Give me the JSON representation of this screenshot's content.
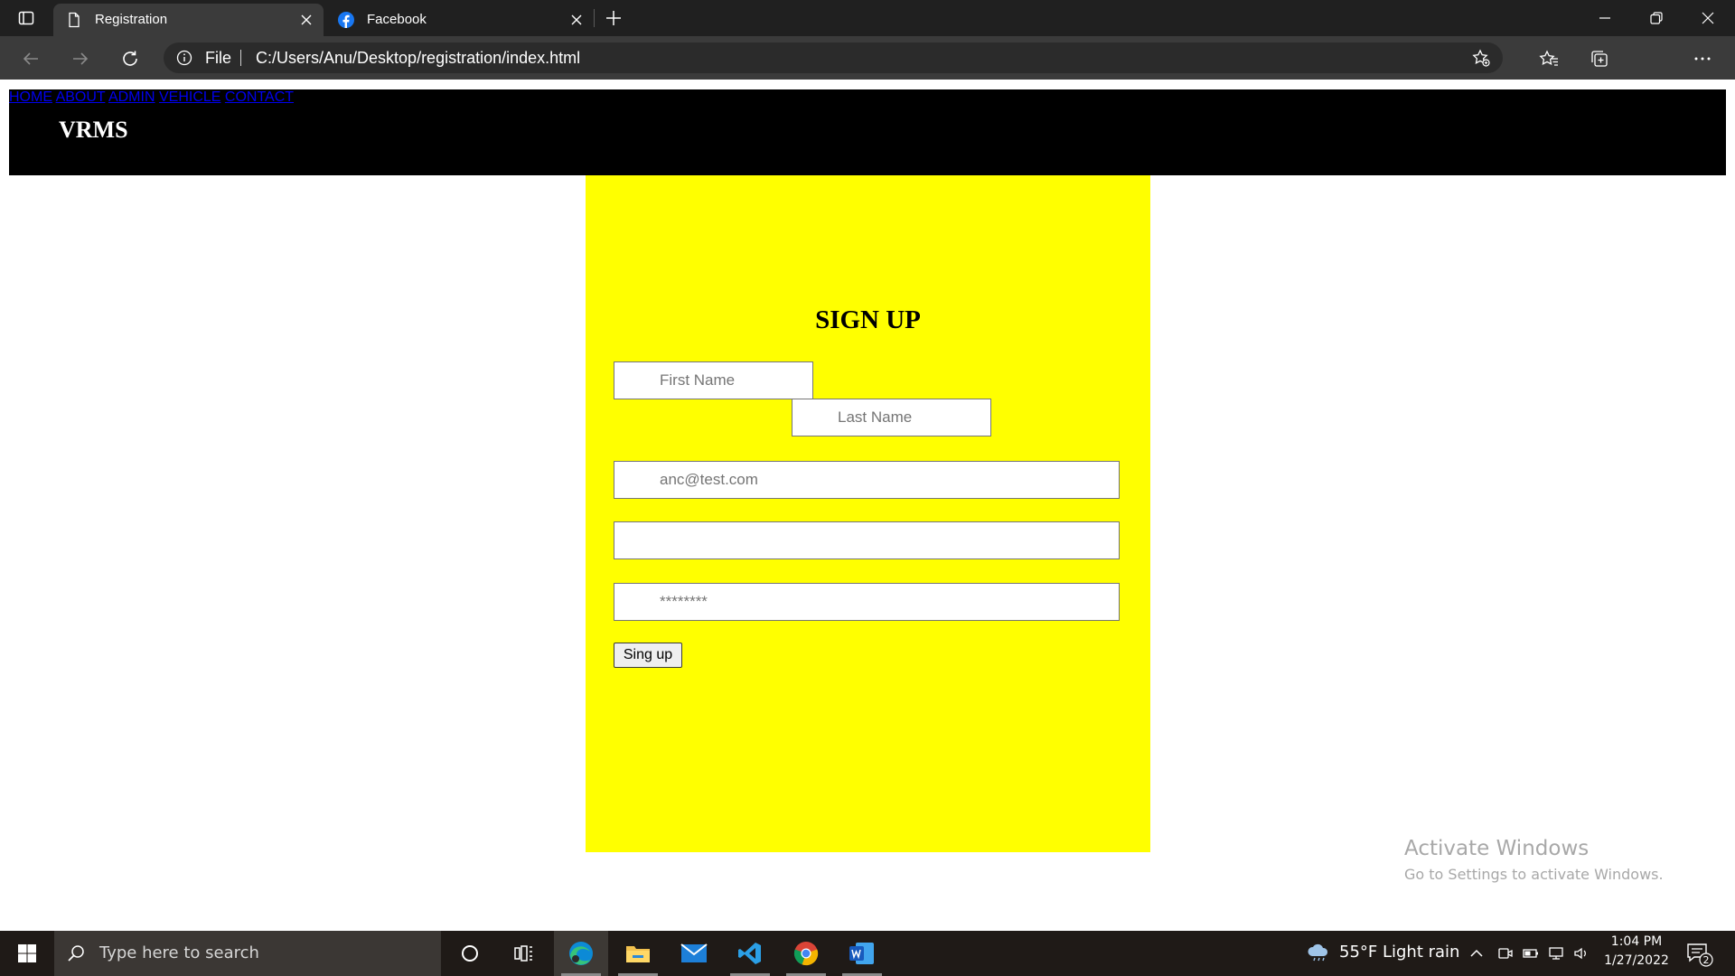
{
  "browser": {
    "tabs": [
      {
        "title": "Registration",
        "icon": "page-icon",
        "active": true
      },
      {
        "title": "Facebook",
        "icon": "facebook-icon",
        "active": false
      }
    ],
    "address": {
      "scheme_label": "File",
      "url": "C:/Users/Anu/Desktop/registration/index.html"
    }
  },
  "site": {
    "logo": "VRMS",
    "menu": [
      "HOME",
      "ABOUT",
      "ADMIN",
      "VEHICLE",
      "CONTACT"
    ]
  },
  "form": {
    "title": "SIGN UP",
    "first_name_placeholder": "First Name",
    "last_name_placeholder": "Last Name",
    "email_placeholder": "anc@test.com",
    "blank_value": "",
    "password_placeholder": "********",
    "submit_label": "Sing up"
  },
  "watermark": {
    "line1": "Activate Windows",
    "line2": "Go to Settings to activate Windows."
  },
  "taskbar": {
    "search_placeholder": "Type here to search",
    "weather": "55°F  Light rain",
    "time": "1:04 PM",
    "date": "1/27/2022",
    "notification_count": "2"
  },
  "colors": {
    "panel": "#ffff00",
    "nav": "#000000",
    "tabbar": "#202020",
    "addressbar": "#3b3b3b"
  }
}
